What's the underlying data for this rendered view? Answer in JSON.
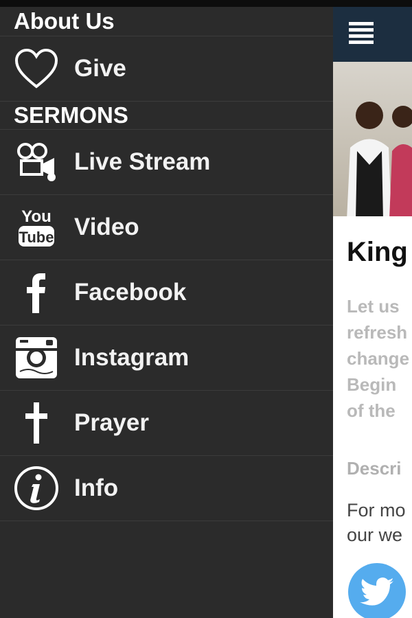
{
  "drawer": {
    "about_label": "About Us",
    "give_label": "Give",
    "sermons_label": "SERMONS",
    "items": [
      {
        "label": "Live Stream",
        "icon": "video-camera-icon"
      },
      {
        "label": "Video",
        "icon": "youtube-icon"
      },
      {
        "label": "Facebook",
        "icon": "facebook-icon"
      },
      {
        "label": "Instagram",
        "icon": "instagram-icon"
      },
      {
        "label": "Prayer",
        "icon": "cross-icon"
      },
      {
        "label": "Info",
        "icon": "info-icon"
      }
    ]
  },
  "content": {
    "title": "King",
    "lines": [
      "Let us",
      "refresh",
      "change",
      "Begin",
      "of the"
    ],
    "desc_label": "Descri",
    "more_lines": [
      "For mo",
      "our we"
    ]
  },
  "colors": {
    "drawer_bg": "#2b2b2b",
    "header_bar": "#1c2e40",
    "twitter": "#55acee"
  }
}
